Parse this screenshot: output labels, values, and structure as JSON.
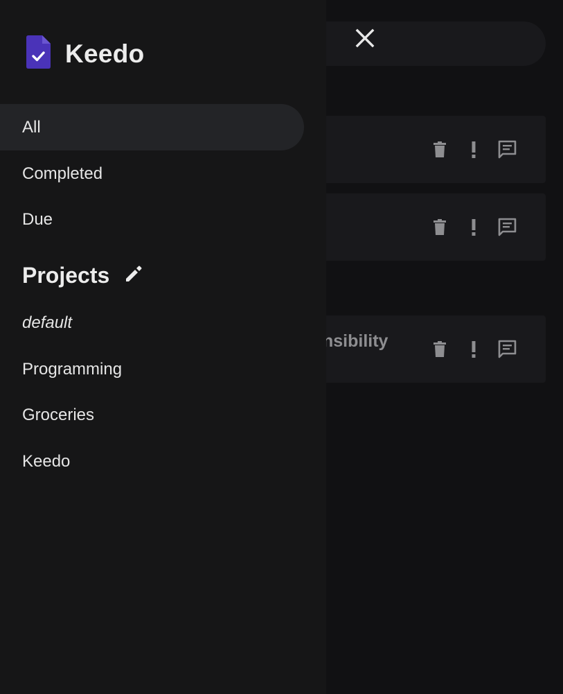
{
  "app": {
    "name": "Keedo",
    "brand_color": "#4a33b8"
  },
  "drawer": {
    "nav_items": [
      {
        "label": "All",
        "active": true
      },
      {
        "label": "Completed",
        "active": false
      },
      {
        "label": "Due",
        "active": false
      }
    ],
    "projects_heading": "Projects",
    "projects": [
      {
        "label": "default",
        "italic": true
      },
      {
        "label": "Programming",
        "italic": false
      },
      {
        "label": "Groceries",
        "italic": false
      },
      {
        "label": "Keedo",
        "italic": false
      }
    ]
  },
  "main": {
    "tasks": [
      {
        "title": "",
        "actions": [
          "delete-icon",
          "priority-icon",
          "comment-icon"
        ]
      },
      {
        "title": "",
        "actions": [
          "delete-icon",
          "priority-icon",
          "comment-icon"
        ]
      },
      {
        "title": "nsibility",
        "actions": [
          "delete-icon",
          "priority-icon",
          "comment-icon"
        ]
      }
    ]
  },
  "icons": {
    "close": "close-icon",
    "logo": "document-check-icon",
    "edit_projects": "pencil-icon"
  },
  "colors": {
    "background": "#111113",
    "drawer": "#161617",
    "active_item": "#232427",
    "text": "#e6e6e6",
    "muted_icon": "#8e8e91"
  }
}
